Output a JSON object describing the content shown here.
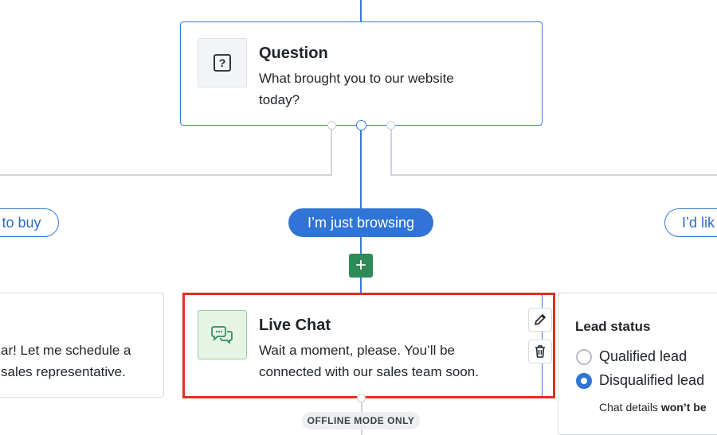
{
  "question_node": {
    "title": "Question",
    "body": "What brought you to our website today?",
    "icon": "question-mark-icon"
  },
  "choices": {
    "left": "to buy",
    "center": "I’m just browsing",
    "right": "I’d lik"
  },
  "add_step": {
    "label": "+"
  },
  "left_node": {
    "body_line1": "ar! Let me schedule a",
    "body_line2": "sales representative."
  },
  "live_chat_node": {
    "title": "Live Chat",
    "body": "Wait a moment, please. You’ll be connected with our sales team soon.",
    "icon": "chat-bubbles-icon"
  },
  "offline_badge": "OFFLINE MODE ONLY",
  "lead_status_panel": {
    "title": "Lead status",
    "options": [
      {
        "label": "Qualified lead",
        "selected": false
      },
      {
        "label": "Disqualified lead",
        "selected": true
      }
    ],
    "footnote_prefix": "Chat details ",
    "footnote_bold": "won’t be"
  },
  "colors": {
    "accent": "#2f74d6",
    "connector": "#3a7bd5",
    "add_button": "#2e8b57",
    "highlight_border": "#e0301e",
    "chat_icon_bg": "#e6f4e6"
  }
}
